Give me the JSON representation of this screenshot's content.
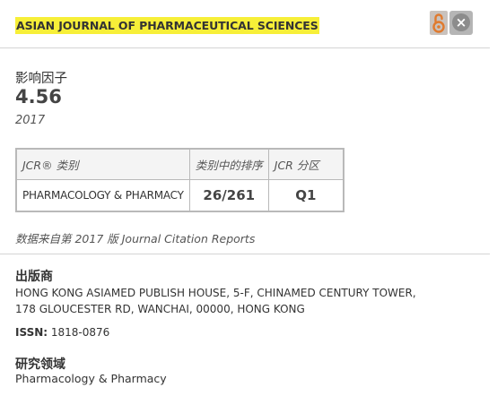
{
  "header": {
    "journal_title": "ASIAN JOURNAL OF PHARMACEUTICAL SCIENCES",
    "open_access_icon": "open-access-lock-icon",
    "close_icon": "close-icon",
    "close_symbol": "×"
  },
  "impact_factor": {
    "label": "影响因子",
    "value": "4.56",
    "year": "2017"
  },
  "jcr_table": {
    "headers": [
      "JCR® 类别",
      "类别中的排序",
      "JCR 分区"
    ],
    "rows": [
      {
        "category": "PHARMACOLOGY & PHARMACY",
        "rank": "26/261",
        "quartile": "Q1"
      }
    ]
  },
  "source_note": "数据来自第 2017 版 Journal Citation Reports",
  "publisher": {
    "label": "出版商",
    "address": "HONG KONG ASIAMED PUBLISH HOUSE, 5-F, CHINAMED CENTURY TOWER, 178 GLOUCESTER RD, WANCHAI, 00000, HONG KONG"
  },
  "issn": {
    "label": "ISSN:",
    "value": "1818-0876"
  },
  "research_area": {
    "label": "研究领域",
    "value": "Pharmacology & Pharmacy"
  },
  "colors": {
    "title_highlight": "#f7ef38",
    "divider": "#d4d4d4",
    "close_button": "#b5b5b5",
    "oa_icon_bg": "#c9c2bd",
    "oa_icon_fg": "#e07a2e"
  }
}
